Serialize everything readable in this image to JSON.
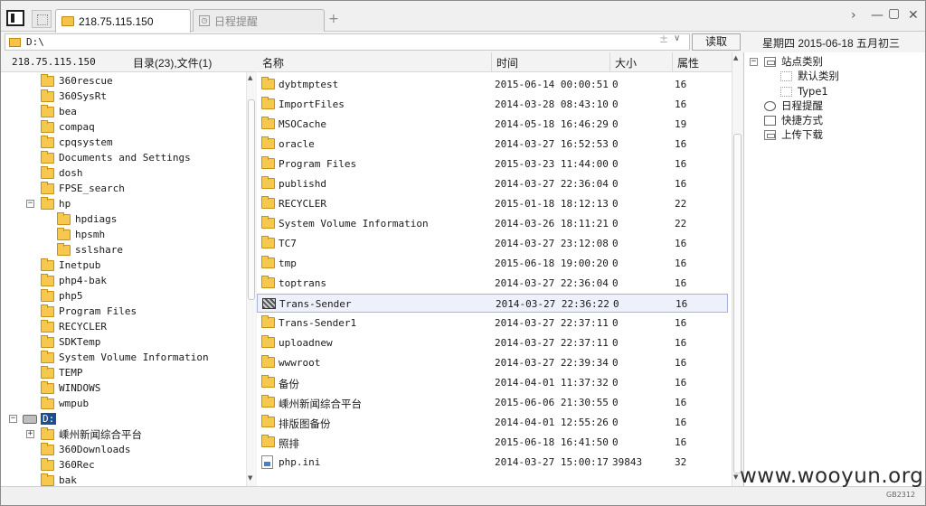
{
  "tabs": {
    "active_label": "218.75.115.150",
    "schedule_label": "日程提醒",
    "add_label": "+"
  },
  "address": {
    "path": "D:\\",
    "add_symbol": "±",
    "dropdown_symbol": "∨",
    "read_button": "读取",
    "date_text": "星期四 2015-06-18 五月初三"
  },
  "left_header": {
    "ip": "218.75.115.150",
    "counts": "目录(23),文件(1)"
  },
  "tree": {
    "c_children": [
      "360rescue",
      "360SysRt",
      "bea",
      "compaq",
      "cpqsystem",
      "Documents and Settings",
      "dosh",
      "FPSE_search",
      "hp"
    ],
    "hp_children": [
      "hpdiags",
      "hpsmh",
      "sslshare"
    ],
    "c_children_after": [
      "Inetpub",
      "php4-bak",
      "php5",
      "Program Files",
      "RECYCLER",
      "SDKTemp",
      "System Volume Information",
      "TEMP",
      "WINDOWS",
      "wmpub"
    ],
    "drive_label": "D:",
    "d_children": [
      "嵊州新闻综合平台",
      "360Downloads",
      "360Rec",
      "bak"
    ]
  },
  "list_header": {
    "name": "名称",
    "time": "时间",
    "size": "大小",
    "attr": "属性"
  },
  "files": [
    {
      "name": "dybtmptest",
      "time": "2015-06-14 00:00:51",
      "size": "0",
      "attr": "16",
      "type": "folder"
    },
    {
      "name": "ImportFiles",
      "time": "2014-03-28 08:43:10",
      "size": "0",
      "attr": "16",
      "type": "folder"
    },
    {
      "name": "MSOCache",
      "time": "2014-05-18 16:46:29",
      "size": "0",
      "attr": "19",
      "type": "folder"
    },
    {
      "name": "oracle",
      "time": "2014-03-27 16:52:53",
      "size": "0",
      "attr": "16",
      "type": "folder"
    },
    {
      "name": "Program Files",
      "time": "2015-03-23 11:44:00",
      "size": "0",
      "attr": "16",
      "type": "folder"
    },
    {
      "name": "publishd",
      "time": "2014-03-27 22:36:04",
      "size": "0",
      "attr": "16",
      "type": "folder"
    },
    {
      "name": "RECYCLER",
      "time": "2015-01-18 18:12:13",
      "size": "0",
      "attr": "22",
      "type": "folder"
    },
    {
      "name": "System Volume Information",
      "time": "2014-03-26 18:11:21",
      "size": "0",
      "attr": "22",
      "type": "folder"
    },
    {
      "name": "TC7",
      "time": "2014-03-27 23:12:08",
      "size": "0",
      "attr": "16",
      "type": "folder"
    },
    {
      "name": "tmp",
      "time": "2015-06-18 19:00:20",
      "size": "0",
      "attr": "16",
      "type": "folder"
    },
    {
      "name": "toptrans",
      "time": "2014-03-27 22:36:04",
      "size": "0",
      "attr": "16",
      "type": "folder"
    },
    {
      "name": "Trans-Sender",
      "time": "2014-03-27 22:36:22",
      "size": "0",
      "attr": "16",
      "type": "special",
      "selected": true
    },
    {
      "name": "Trans-Sender1",
      "time": "2014-03-27 22:37:11",
      "size": "0",
      "attr": "16",
      "type": "folder"
    },
    {
      "name": "uploadnew",
      "time": "2014-03-27 22:37:11",
      "size": "0",
      "attr": "16",
      "type": "folder"
    },
    {
      "name": "wwwroot",
      "time": "2014-03-27 22:39:34",
      "size": "0",
      "attr": "16",
      "type": "folder"
    },
    {
      "name": "备份",
      "time": "2014-04-01 11:37:32",
      "size": "0",
      "attr": "16",
      "type": "folder"
    },
    {
      "name": "嵊州新闻综合平台",
      "time": "2015-06-06 21:30:55",
      "size": "0",
      "attr": "16",
      "type": "folder"
    },
    {
      "name": "排版图备份",
      "time": "2014-04-01 12:55:26",
      "size": "0",
      "attr": "16",
      "type": "folder"
    },
    {
      "name": "照排",
      "time": "2015-06-18 16:41:50",
      "size": "0",
      "attr": "16",
      "type": "folder"
    },
    {
      "name": "php.ini",
      "time": "2014-03-27 15:00:17",
      "size": "39843",
      "attr": "32",
      "type": "file"
    }
  ],
  "right_tree": {
    "site_category": "站点类别",
    "default_category": "默认类别",
    "type1": "Type1",
    "schedule": "日程提醒",
    "shortcuts": "快捷方式",
    "transfers": "上传下载"
  },
  "watermark": "www.wooyun.org",
  "badge": "GB2312",
  "colors": {
    "folder": "#f6c94e",
    "selection": "#1c4f8f",
    "row_highlight": "#eef0fb"
  }
}
